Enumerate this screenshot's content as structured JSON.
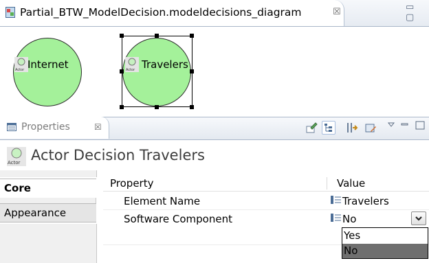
{
  "editor": {
    "tab_title": "Partial_BTW_ModelDecision.modeldecisions_diagram",
    "close_glyph": "☒",
    "window_buttons": "▭ ▢"
  },
  "diagram": {
    "actors": [
      {
        "label": "Internet",
        "icon_text": "Actor",
        "selected": false
      },
      {
        "label": "Travelers",
        "icon_text": "Actor",
        "selected": true
      }
    ],
    "fill_color": "#a4f19a"
  },
  "properties_view": {
    "tab_title": "Properties",
    "close_glyph": "☒",
    "header_title": "Actor Decision Travelers",
    "header_icon_text": "Actor",
    "toolbar": [
      "pin-icon",
      "tree-icon",
      "filter-icon",
      "restore-icon",
      "view-menu-icon",
      "minimize-icon",
      "maximize-icon"
    ],
    "sections": [
      {
        "label": "Core",
        "active": true
      },
      {
        "label": "Appearance",
        "active": false
      }
    ],
    "columns": {
      "property": "Property",
      "value": "Value"
    },
    "rows": [
      {
        "property": "Element Name",
        "value": "Travelers"
      },
      {
        "property": "Software Component",
        "value": "No"
      }
    ],
    "dropdown": {
      "options": [
        "Yes",
        "No"
      ],
      "selected": "No"
    }
  }
}
